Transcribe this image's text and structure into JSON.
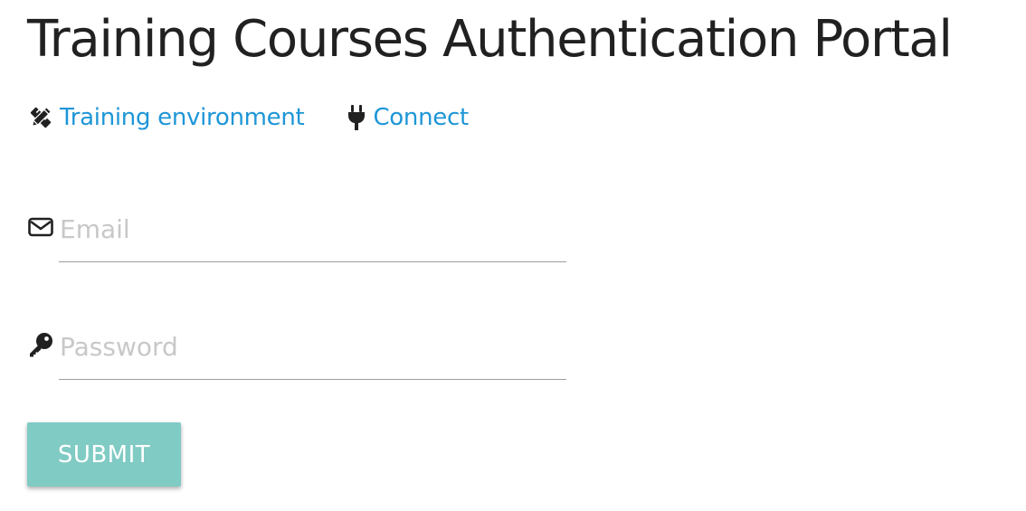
{
  "page": {
    "title": "Training Courses Authentication Portal"
  },
  "nav": {
    "items": [
      {
        "label": "Training environment",
        "icon": "pencil-ruler-icon"
      },
      {
        "label": "Connect",
        "icon": "plug-icon"
      }
    ],
    "link_color": "#1e96d7"
  },
  "form": {
    "email": {
      "placeholder": "Email",
      "value": "",
      "icon": "envelope-icon"
    },
    "password": {
      "placeholder": "Password",
      "value": "",
      "icon": "key-icon"
    },
    "submit_label": "SUBMIT",
    "submit_color": "#80cbc4"
  }
}
